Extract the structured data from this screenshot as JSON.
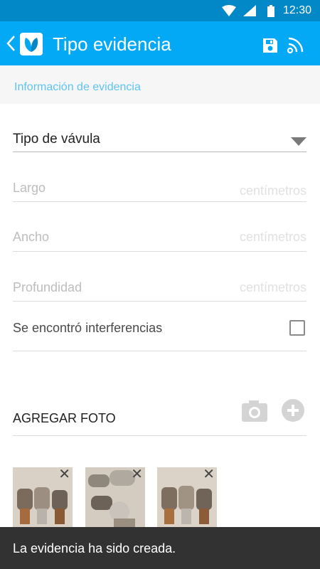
{
  "status_bar": {
    "time": "12:30",
    "icons": [
      "wifi-icon",
      "signal-icon",
      "battery-icon"
    ]
  },
  "app_bar": {
    "title": "Tipo evidencia",
    "color": "#03a9f4",
    "actions": [
      "save-icon",
      "rss-icon"
    ]
  },
  "section": {
    "title": "Información de evidencia"
  },
  "form": {
    "valve_type": {
      "label": "Tipo de vávula"
    },
    "length": {
      "placeholder": "Largo",
      "unit": "centímetros"
    },
    "width": {
      "placeholder": "Ancho",
      "unit": "centímetros"
    },
    "depth": {
      "placeholder": "Profundidad",
      "unit": "centímetros"
    },
    "interference": {
      "label": "Se encontró interferencias",
      "checked": false
    }
  },
  "photos": {
    "add_label": "AGREGAR FOTO",
    "items": [
      {
        "remove": "✕"
      },
      {
        "remove": "✕"
      },
      {
        "remove": "✕"
      }
    ]
  },
  "snackbar": {
    "message": "La evidencia ha sido creada."
  }
}
